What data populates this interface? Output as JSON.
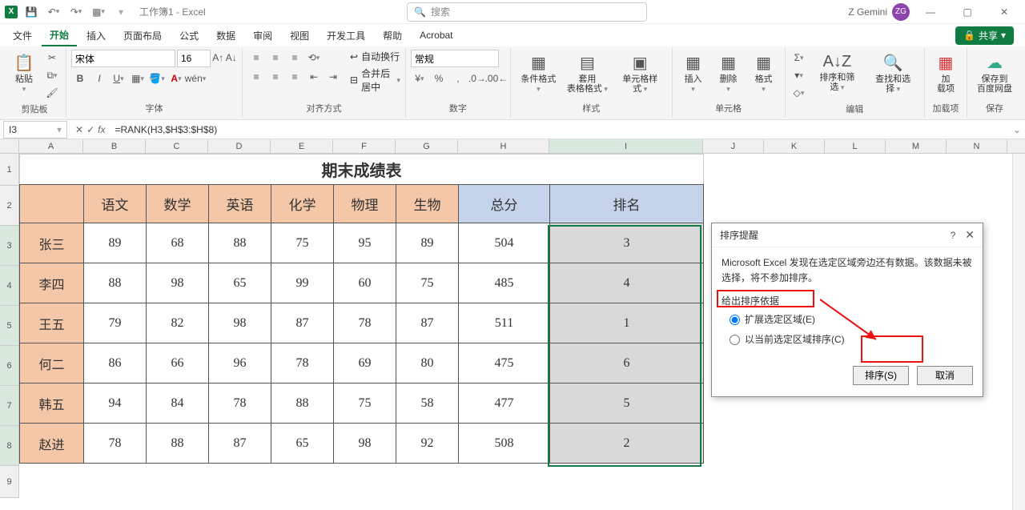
{
  "titlebar": {
    "doc_title": "工作簿1 - Excel",
    "search_placeholder": "搜索",
    "user_name": "Z Gemini",
    "user_initials": "ZG"
  },
  "tabs": {
    "file": "文件",
    "home": "开始",
    "insert": "插入",
    "layout": "页面布局",
    "formulas": "公式",
    "data": "数据",
    "review": "审阅",
    "view": "视图",
    "dev": "开发工具",
    "help": "帮助",
    "acrobat": "Acrobat",
    "share": "共享"
  },
  "ribbon": {
    "paste": "粘贴",
    "clipboard": "剪贴板",
    "font_name": "宋体",
    "font_size": "16",
    "font_group": "字体",
    "align_group": "对齐方式",
    "wrap": "自动换行",
    "merge": "合并后居中",
    "number_format": "常规",
    "number_group": "数字",
    "cond_fmt": "条件格式",
    "table_fmt": "套用\n表格格式",
    "cell_style": "单元格样式",
    "styles_group": "样式",
    "insert_c": "插入",
    "delete_c": "删除",
    "format_c": "格式",
    "cells_group": "单元格",
    "sort_filter": "排序和筛选",
    "find_select": "查找和选择",
    "edit_group": "编辑",
    "addin": "加\n载项",
    "addin_group": "加载项",
    "baidu": "保存到\n百度网盘",
    "baidu_group": "保存"
  },
  "formula_bar": {
    "name_box": "I3",
    "formula": "=RANK(H3,$H$3:$H$8)"
  },
  "columns": [
    "A",
    "B",
    "C",
    "D",
    "E",
    "F",
    "G",
    "H",
    "I",
    "J",
    "K",
    "L",
    "M",
    "N"
  ],
  "rows": [
    "1",
    "2",
    "3",
    "4",
    "5",
    "6",
    "7",
    "8",
    "9"
  ],
  "sheet": {
    "title": "期末成绩表",
    "headers": [
      "",
      "语文",
      "数学",
      "英语",
      "化学",
      "物理",
      "生物",
      "总分",
      "排名"
    ],
    "data": [
      {
        "name": "张三",
        "scores": [
          89,
          68,
          88,
          75,
          95,
          89
        ],
        "total": 504,
        "rank": 3
      },
      {
        "name": "李四",
        "scores": [
          88,
          98,
          65,
          99,
          60,
          75
        ],
        "total": 485,
        "rank": 4
      },
      {
        "name": "王五",
        "scores": [
          79,
          82,
          98,
          87,
          78,
          87
        ],
        "total": 511,
        "rank": 1
      },
      {
        "name": "何二",
        "scores": [
          86,
          66,
          96,
          78,
          69,
          80
        ],
        "total": 475,
        "rank": 6
      },
      {
        "name": "韩五",
        "scores": [
          94,
          84,
          78,
          88,
          75,
          58
        ],
        "total": 477,
        "rank": 5
      },
      {
        "name": "赵进",
        "scores": [
          78,
          88,
          87,
          65,
          98,
          92
        ],
        "total": 508,
        "rank": 2
      }
    ]
  },
  "dialog": {
    "title": "排序提醒",
    "message": "Microsoft Excel 发现在选定区域旁边还有数据。该数据未被选择，将不参加排序。",
    "group_label": "给出排序依据",
    "opt_expand": "扩展选定区域(E)",
    "opt_current": "以当前选定区域排序(C)",
    "btn_sort": "排序(S)",
    "btn_cancel": "取消"
  }
}
